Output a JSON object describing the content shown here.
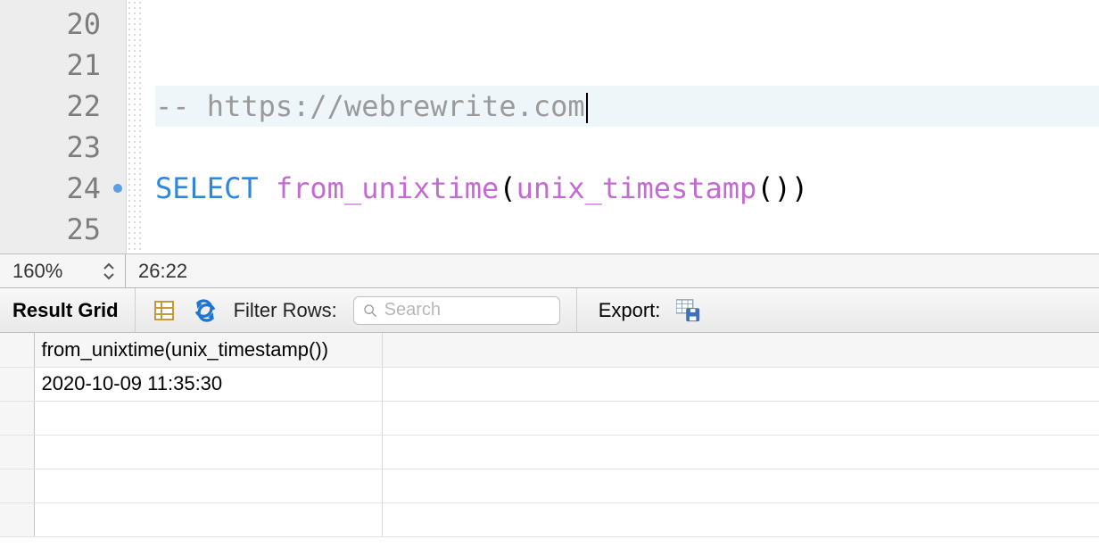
{
  "editor": {
    "lines": [
      {
        "n": 20,
        "tokens": []
      },
      {
        "n": 21,
        "tokens": []
      },
      {
        "n": 22,
        "highlight": true,
        "caret": true,
        "tokens": [
          {
            "t": "-- https://webrewrite.com",
            "cls": "tok-comment"
          }
        ]
      },
      {
        "n": 23,
        "tokens": []
      },
      {
        "n": 24,
        "marker": true,
        "tokens": [
          {
            "t": "SELECT",
            "cls": "tok-keyword"
          },
          {
            "t": " ",
            "cls": ""
          },
          {
            "t": "from_unixtime",
            "cls": "tok-func"
          },
          {
            "t": "(",
            "cls": "tok-paren"
          },
          {
            "t": "unix_timestamp",
            "cls": "tok-func"
          },
          {
            "t": "(",
            "cls": "tok-paren"
          },
          {
            "t": ")",
            "cls": "tok-paren"
          },
          {
            "t": ")",
            "cls": "tok-paren"
          }
        ]
      },
      {
        "n": 25,
        "tokens": []
      }
    ]
  },
  "status": {
    "zoom": "160%",
    "cursor": "26:22"
  },
  "toolbar": {
    "result_grid_label": "Result Grid",
    "filter_label": "Filter Rows:",
    "search_placeholder": "Search",
    "export_label": "Export:"
  },
  "results": {
    "columns": [
      "from_unixtime(unix_timestamp())"
    ],
    "rows": [
      [
        "2020-10-09 11:35:30"
      ]
    ],
    "empty_rows": 4
  }
}
